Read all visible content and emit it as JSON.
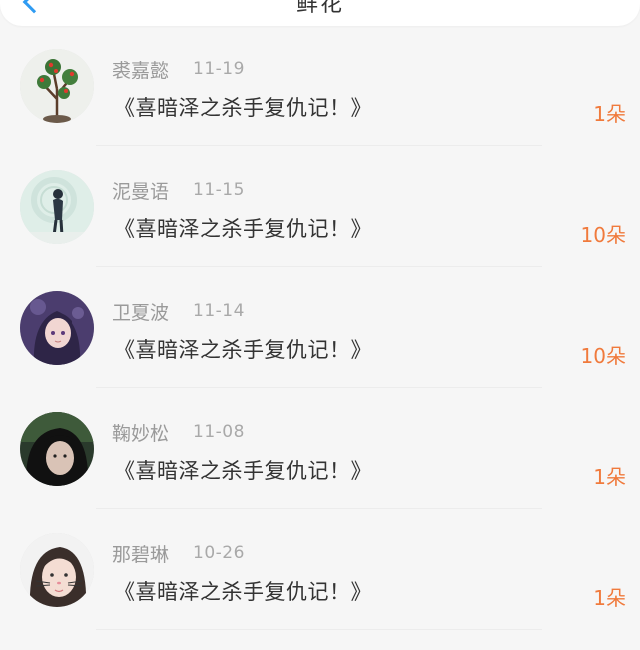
{
  "header": {
    "title": "鲜花"
  },
  "colors": {
    "accent": "#2f9bf2",
    "amount": "#f07a3c"
  },
  "items": [
    {
      "name": "裘嘉懿",
      "date": "11-19",
      "content": "《喜暗泽之杀手复仇记！》",
      "amount": "1朵",
      "avatar": "bonsai-tree-avatar"
    },
    {
      "name": "泥曼语",
      "date": "11-15",
      "content": "《喜暗泽之杀手复仇记！》",
      "amount": "10朵",
      "avatar": "person-silhouette-avatar"
    },
    {
      "name": "卫夏波",
      "date": "11-14",
      "content": "《喜暗泽之杀手复仇记！》",
      "amount": "10朵",
      "avatar": "anime-girl-avatar"
    },
    {
      "name": "鞠妙松",
      "date": "11-08",
      "content": "《喜暗泽之杀手复仇记！》",
      "amount": "1朵",
      "avatar": "dark-hair-girl-avatar"
    },
    {
      "name": "那碧琳",
      "date": "10-26",
      "content": "《喜暗泽之杀手复仇记！》",
      "amount": "1朵",
      "avatar": "cat-filter-girl-avatar"
    }
  ]
}
